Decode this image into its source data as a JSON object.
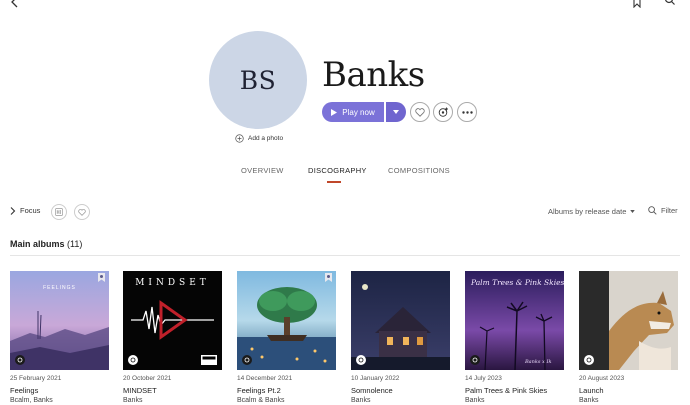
{
  "header": {
    "back_icon": "chevron-left-icon",
    "bookmark_icon": "bookmark-icon",
    "search_icon": "search-icon"
  },
  "artist": {
    "initials": "BS",
    "name": "Banks",
    "add_photo_label": "Add a photo"
  },
  "actions": {
    "play_label": "Play now",
    "play_icon": "play-icon",
    "dropdown_icon": "chevron-down-icon",
    "like_icon": "heart-icon",
    "follow_icon": "add-follow-icon",
    "more_icon": "more-icon"
  },
  "tabs": [
    {
      "label": "OVERVIEW",
      "active": false
    },
    {
      "label": "DISCOGRAPHY",
      "active": true
    },
    {
      "label": "COMPOSITIONS",
      "active": false
    }
  ],
  "filters": {
    "focus_label": "Focus",
    "sort_label": "Albums by release date",
    "filter_label": "Filter"
  },
  "section": {
    "title": "Main albums",
    "count": "(11)"
  },
  "albums": [
    {
      "date": "25 February 2021",
      "title": "Feelings",
      "artist": "Bcalm, Banks",
      "cover_text": "FEELINGS"
    },
    {
      "date": "20 October 2021",
      "title": "MINDSET",
      "artist": "Banks",
      "cover_text": "MINDSET"
    },
    {
      "date": "14 December 2021",
      "title": "Feelings Pt.2",
      "artist": "Bcalm & Banks"
    },
    {
      "date": "10 January 2022",
      "title": "Somnolence",
      "artist": "Banks"
    },
    {
      "date": "14 July 2023",
      "title": "Palm Trees & Pink Skies",
      "artist": "Banks",
      "cover_text": "Palm Trees & Pink Skies",
      "cover_signature": "Banks x Ik"
    },
    {
      "date": "20 August 2023",
      "title": "Launch",
      "artist": "Banks"
    }
  ],
  "colors": {
    "accent": "#7b72d8",
    "tab_underline": "#c0472a",
    "avatar_bg": "#ccd6e6"
  }
}
